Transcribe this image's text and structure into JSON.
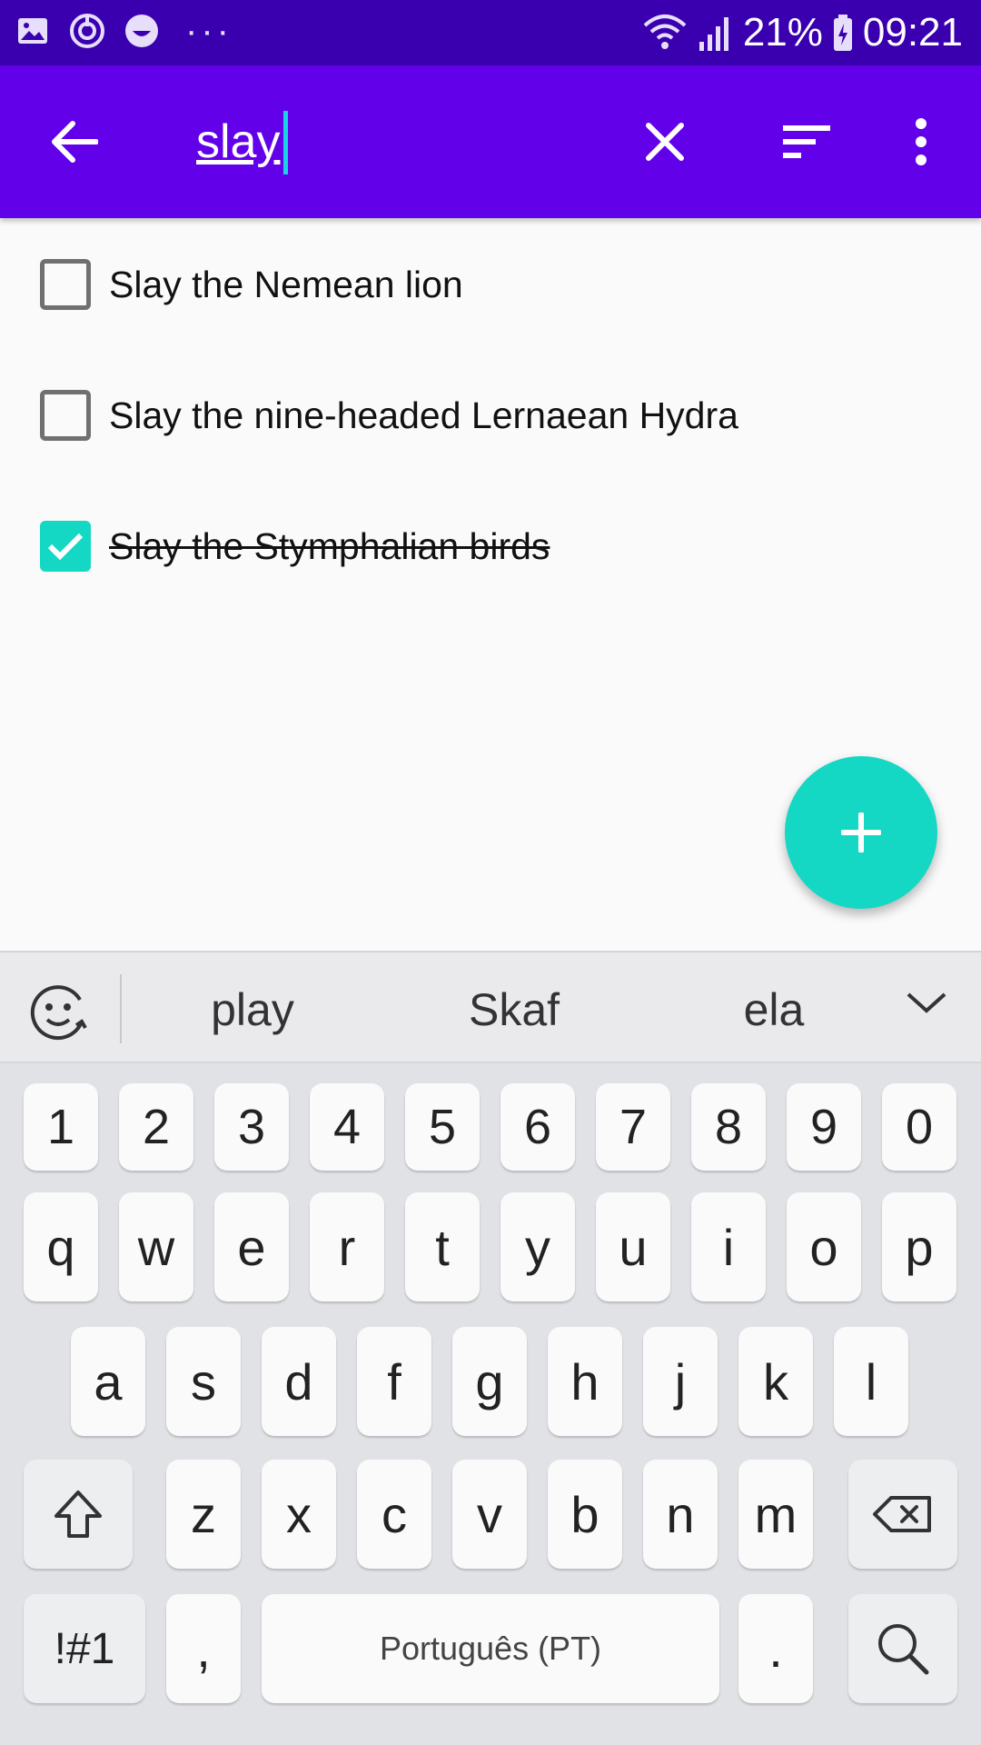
{
  "status_bar": {
    "icons_left": [
      "gallery-icon",
      "sync-icon",
      "smile-icon"
    ],
    "more": "···",
    "battery_percent": "21%",
    "time": "09:21"
  },
  "toolbar": {
    "search_value": "slay",
    "back_icon": "arrow-left-icon",
    "clear_icon": "close-icon",
    "sort_icon": "sort-icon",
    "more_icon": "more-vert-icon"
  },
  "tasks": [
    {
      "label": "Slay the Nemean lion",
      "checked": false
    },
    {
      "label": "Slay the nine-headed Lernaean Hydra",
      "checked": false
    },
    {
      "label": "Slay the Stymphalian birds",
      "checked": true
    }
  ],
  "fab": {
    "icon": "plus-icon"
  },
  "suggestions": {
    "words": [
      "play",
      "Skaf",
      "ela"
    ]
  },
  "keyboard": {
    "row_numbers": [
      "1",
      "2",
      "3",
      "4",
      "5",
      "6",
      "7",
      "8",
      "9",
      "0"
    ],
    "row1": [
      "q",
      "w",
      "e",
      "r",
      "t",
      "y",
      "u",
      "i",
      "o",
      "p"
    ],
    "row2": [
      "a",
      "s",
      "d",
      "f",
      "g",
      "h",
      "j",
      "k",
      "l"
    ],
    "row3": [
      "z",
      "x",
      "c",
      "v",
      "b",
      "n",
      "m"
    ],
    "symbols_label": "!#1",
    "comma_label": ",",
    "space_label": "Português (PT)",
    "period_label": "."
  },
  "colors": {
    "status_bar": "#3a00b0",
    "toolbar": "#6200ea",
    "accent": "#14d8c4"
  }
}
